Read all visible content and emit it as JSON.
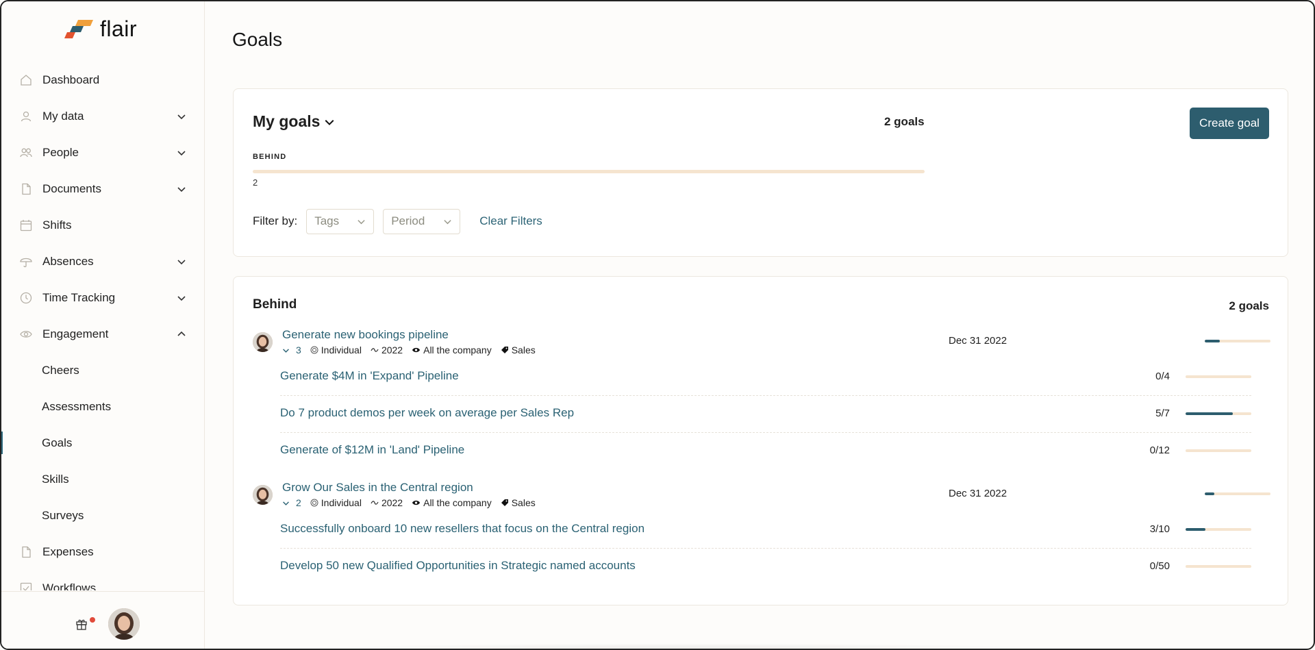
{
  "app": {
    "brand": "flair"
  },
  "colors": {
    "accent": "#2d5d6e",
    "link": "#2a6173",
    "progress_track": "#f5e4cf",
    "notification_dot": "#e14b3b"
  },
  "sidebar": {
    "items": [
      {
        "label": "Dashboard",
        "icon": "home-icon",
        "expandable": false
      },
      {
        "label": "My data",
        "icon": "user-icon",
        "expandable": true
      },
      {
        "label": "People",
        "icon": "people-icon",
        "expandable": true
      },
      {
        "label": "Documents",
        "icon": "document-icon",
        "expandable": true
      },
      {
        "label": "Shifts",
        "icon": "calendar-icon",
        "expandable": false
      },
      {
        "label": "Absences",
        "icon": "umbrella-icon",
        "expandable": true
      },
      {
        "label": "Time Tracking",
        "icon": "clock-icon",
        "expandable": true
      },
      {
        "label": "Engagement",
        "icon": "eye-icon",
        "expandable": true,
        "expanded": true
      }
    ],
    "engagement_sub": [
      {
        "label": "Cheers"
      },
      {
        "label": "Assessments"
      },
      {
        "label": "Goals",
        "active": true
      },
      {
        "label": "Skills"
      },
      {
        "label": "Surveys"
      }
    ],
    "items_after": [
      {
        "label": "Expenses",
        "icon": "document-icon"
      },
      {
        "label": "Workflows",
        "icon": "checkbox-icon"
      }
    ]
  },
  "page": {
    "title": "Goals"
  },
  "my_goals": {
    "title": "My goals",
    "count_label": "2 goals",
    "create_button": "Create goal",
    "status_label": "BEHIND",
    "status_count": "2",
    "status_fraction": 1.0,
    "filter_label": "Filter by:",
    "filters": {
      "tags_placeholder": "Tags",
      "period_placeholder": "Period"
    },
    "clear_filters": "Clear Filters"
  },
  "behind_section": {
    "title": "Behind",
    "count_label": "2 goals",
    "goals": [
      {
        "title": "Generate new bookings pipeline",
        "subgoal_count": "3",
        "type": "Individual",
        "period": "2022",
        "visibility": "All the company",
        "tag": "Sales",
        "due": "Dec 31 2022",
        "progress": 0.23,
        "key_results": [
          {
            "title": "Generate $4M in 'Expand' Pipeline",
            "value": "0/4",
            "progress": 0.0
          },
          {
            "title": "Do 7 product demos per week on average per Sales Rep",
            "value": "5/7",
            "progress": 0.714
          },
          {
            "title": "Generate of $12M in 'Land' Pipeline",
            "value": "0/12",
            "progress": 0.0
          }
        ]
      },
      {
        "title": "Grow Our Sales in the Central region",
        "subgoal_count": "2",
        "type": "Individual",
        "period": "2022",
        "visibility": "All the company",
        "tag": "Sales",
        "due": "Dec 31 2022",
        "progress": 0.15,
        "key_results": [
          {
            "title": "Successfully onboard 10 new resellers that focus on the Central region",
            "value": "3/10",
            "progress": 0.3
          },
          {
            "title": "Develop 50 new Qualified Opportunities in Strategic named accounts",
            "value": "0/50",
            "progress": 0.0
          }
        ]
      }
    ]
  }
}
